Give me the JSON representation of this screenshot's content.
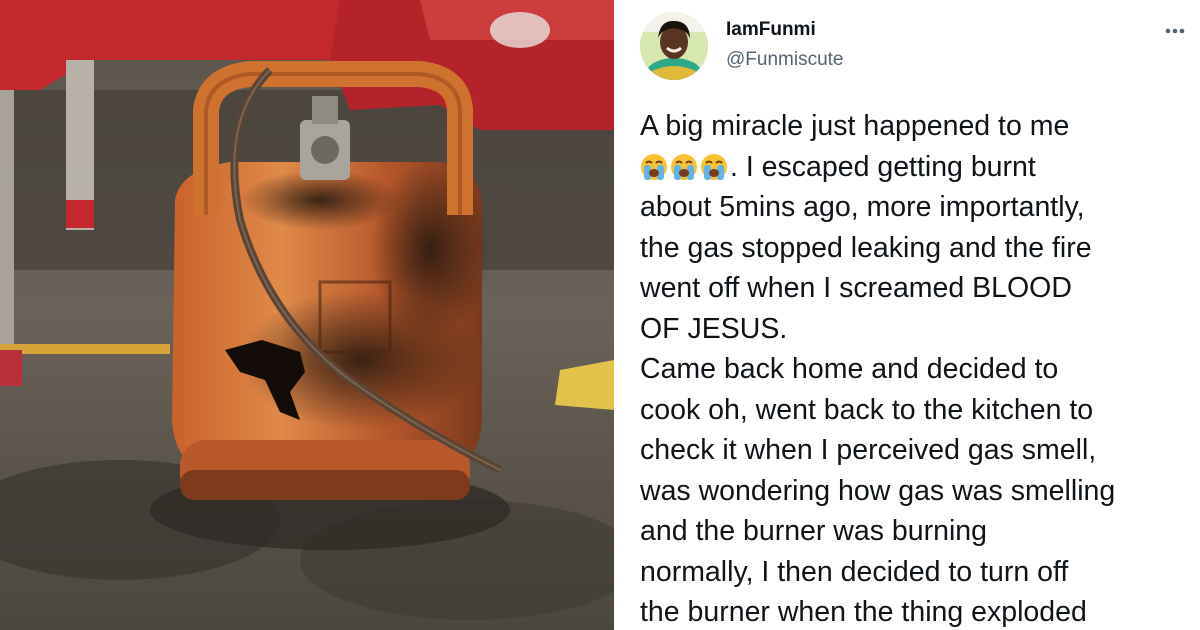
{
  "tweet": {
    "display_name": "IamFunmi",
    "handle": "@Funmiscute",
    "more_icon": "more-horizontal-icon",
    "lines": [
      "A big miracle just happened to me",
      ". I escaped getting burnt",
      "about 5mins ago, more importantly,",
      "the gas stopped leaking and the fire",
      "went off when I screamed BLOOD",
      "OF JESUS.",
      "Came back home and decided to",
      "cook oh, went back to the kitchen to",
      "check it when I perceived gas smell,",
      "was wondering how gas was smelling",
      "and the burner was burning",
      "normally, I then decided to turn off",
      "the burner when the thing exploded"
    ],
    "emoji_icon": "loudly-crying-face-icon",
    "emoji_count": 3
  },
  "photo": {
    "subject_icon": "burnt-gas-cylinder-photo"
  },
  "colors": {
    "name": "#0f1419",
    "handle": "#536471",
    "cylinder": "#d4692b"
  }
}
